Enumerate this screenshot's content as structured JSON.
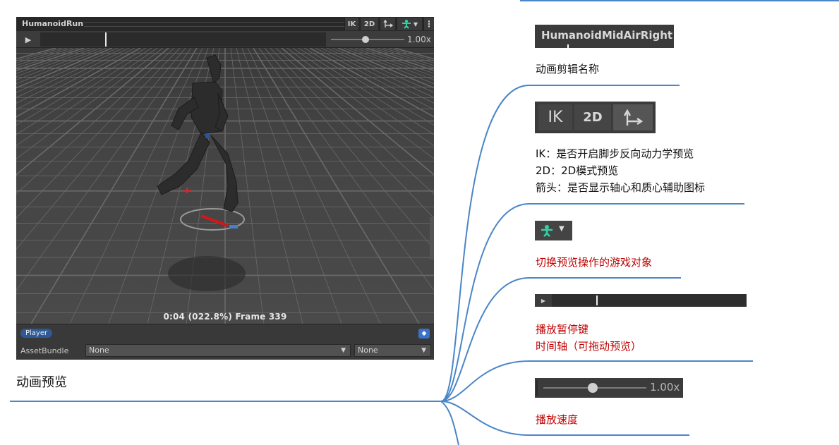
{
  "preview": {
    "clip_title": "HumanoidRun",
    "toolbar": {
      "ik": "IK",
      "twod": "2D",
      "pivot_icon": "pivot-arrows-icon",
      "avatar_icon": "avatar-figure-icon",
      "menu_icon": "kebab-menu-icon"
    },
    "speed": "1.00x",
    "speed_fraction": 0.47,
    "frame_info": "0:04 (022.8%) Frame 339",
    "player_badge": "Player",
    "asset_bundle_label": "AssetBundle",
    "asset_bundle_value": "None",
    "asset_bundle_variant": "None"
  },
  "left_caption": "动画预览",
  "annotations": {
    "clip_name_crop": "HumanoidMidAirRight",
    "clip_name": "动画剪辑名称",
    "buttons_crop": {
      "ik": "IK",
      "twod": "2D"
    },
    "buttons_desc": [
      "IK：是否开启脚步反向动力学预览",
      "2D：2D模式预览",
      "箭头：是否显示轴心和质心辅助图标"
    ],
    "switch_object": "切换预览操作的游戏对象",
    "play_pause": "播放暂停键",
    "timeline": "时间轴（可拖动预览）",
    "speed_crop": "1.00x",
    "speed": "播放速度"
  },
  "colors": {
    "line_blue": "#4a86c8",
    "red_text": "#c00000",
    "panel_bg": "#383838"
  }
}
